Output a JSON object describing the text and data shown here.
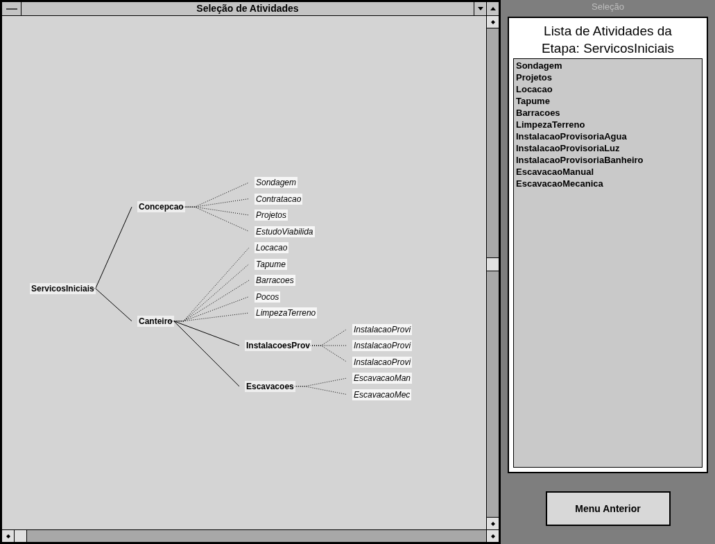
{
  "window": {
    "title": "Seleção de Atividades"
  },
  "tree": {
    "label": "ServicosIniciais",
    "children": [
      {
        "label": "Concepcao",
        "children": [
          {
            "label": "Sondagem"
          },
          {
            "label": "Contratacao"
          },
          {
            "label": "Projetos"
          },
          {
            "label": "EstudoViabilida"
          }
        ]
      },
      {
        "label": "Canteiro",
        "children": [
          {
            "label": "Locacao"
          },
          {
            "label": "Tapume"
          },
          {
            "label": "Barracoes"
          },
          {
            "label": "Pocos"
          },
          {
            "label": "LimpezaTerreno"
          },
          {
            "label": "InstalacoesProv",
            "children": [
              {
                "label": "InstalacaoProvi"
              },
              {
                "label": "InstalacaoProvi"
              },
              {
                "label": "InstalacaoProvi"
              }
            ]
          },
          {
            "label": "Escavacoes",
            "children": [
              {
                "label": "EscavacaoMan"
              },
              {
                "label": "EscavacaoMec"
              }
            ]
          }
        ]
      }
    ]
  },
  "side_panel": {
    "title": "Seleção",
    "heading": [
      "Lista de Atividades da",
      "Etapa: ServicosIniciais"
    ],
    "items": [
      "Sondagem",
      "Projetos",
      "Locacao",
      "Tapume",
      "Barracoes",
      "LimpezaTerreno",
      "InstalacaoProvisoriaAgua",
      "InstalacaoProvisoriaLuz",
      "InstalacaoProvisoriaBanheiro",
      "EscavacaoManual",
      "EscavacaoMecanica"
    ],
    "button": "Menu Anterior"
  }
}
